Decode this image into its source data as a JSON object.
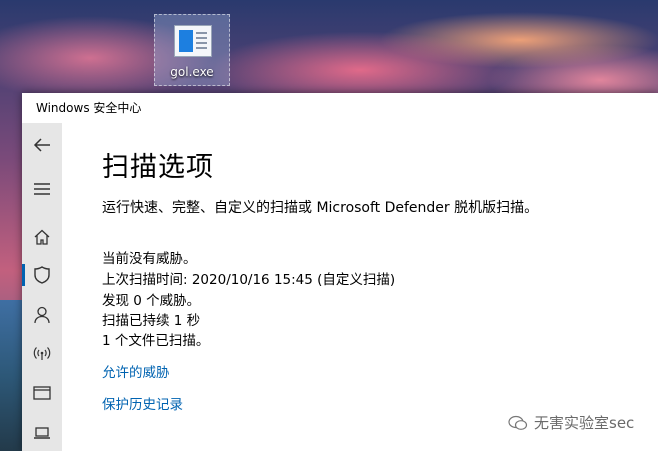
{
  "desktop": {
    "icon_label": "gol.exe"
  },
  "window": {
    "title": "Windows 安全中心"
  },
  "sidebar": {
    "items": [
      {
        "name": "back-arrow-icon"
      },
      {
        "name": "hamburger-menu-icon"
      },
      {
        "name": "home-icon"
      },
      {
        "name": "shield-icon",
        "active": true
      },
      {
        "name": "account-person-icon"
      },
      {
        "name": "network-wifi-icon"
      },
      {
        "name": "app-browser-icon"
      },
      {
        "name": "device-laptop-icon"
      }
    ],
    "accent_color": "#0063b1"
  },
  "main": {
    "title": "扫描选项",
    "description": "运行快速、完整、自定义的扫描或 Microsoft Defender 脱机版扫描。",
    "status": {
      "no_threats": "当前没有威胁。",
      "last_scan": "上次扫描时间: 2020/10/16 15:45 (自定义扫描)",
      "found": "发现 0 个威胁。",
      "duration": "扫描已持续 1 秒",
      "files_scanned": "1 个文件已扫描。"
    },
    "links": {
      "allowed_threats": "允许的威胁",
      "protection_history": "保护历史记录"
    },
    "link_color": "#0063b1"
  },
  "watermark": {
    "text": "无害实验室sec"
  }
}
